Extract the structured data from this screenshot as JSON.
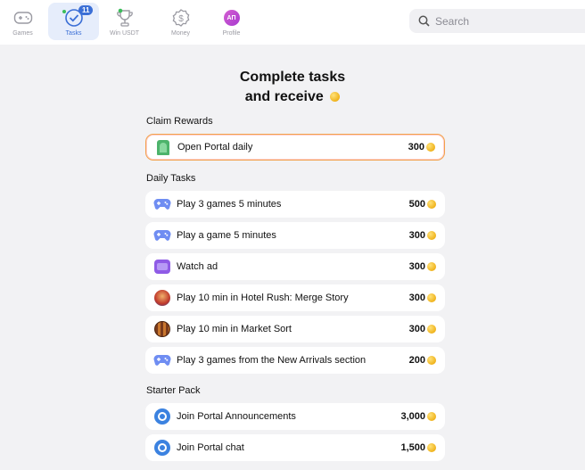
{
  "nav": {
    "items": [
      {
        "label": "Games",
        "icon": "gamepad-icon"
      },
      {
        "label": "Tasks",
        "icon": "check-circle-icon",
        "badge": "11"
      },
      {
        "label": "Win USDT",
        "icon": "trophy-icon"
      },
      {
        "label": "Money",
        "icon": "dollar-icon"
      },
      {
        "label": "Profile",
        "icon": "avatar",
        "avatar_text": "AП"
      }
    ],
    "active": "Tasks"
  },
  "search": {
    "placeholder": "Search"
  },
  "headline": {
    "line1": "Complete tasks",
    "line2": "and receive"
  },
  "sections": {
    "claim": {
      "title": "Claim Rewards",
      "items": [
        {
          "label": "Open Portal daily",
          "value": "300",
          "icon": "portal-door-icon"
        }
      ]
    },
    "daily": {
      "title": "Daily Tasks",
      "items": [
        {
          "label": "Play 3 games 5 minutes",
          "value": "500",
          "icon": "gamepad-icon"
        },
        {
          "label": "Play a game 5 minutes",
          "value": "300",
          "icon": "gamepad-icon"
        },
        {
          "label": "Watch ad",
          "value": "300",
          "icon": "tv-icon"
        },
        {
          "label": "Play 10 min in Hotel Rush: Merge Story",
          "value": "300",
          "icon": "hotel-rush-game-icon"
        },
        {
          "label": "Play 10 min in Market Sort",
          "value": "300",
          "icon": "market-sort-game-icon"
        },
        {
          "label": "Play 3 games from the New Arrivals section",
          "value": "200",
          "icon": "gamepad-icon"
        }
      ]
    },
    "starter": {
      "title": "Starter Pack",
      "items": [
        {
          "label": "Join Portal Announcements",
          "value": "3,000",
          "icon": "portal-chat-icon"
        },
        {
          "label": "Join Portal chat",
          "value": "1,500",
          "icon": "portal-chat-icon"
        }
      ]
    }
  },
  "colors": {
    "accent": "#3b6fd6",
    "coin": "#f0b31c",
    "highlight_border": "#f2a14a",
    "background": "#f2f2f4"
  }
}
